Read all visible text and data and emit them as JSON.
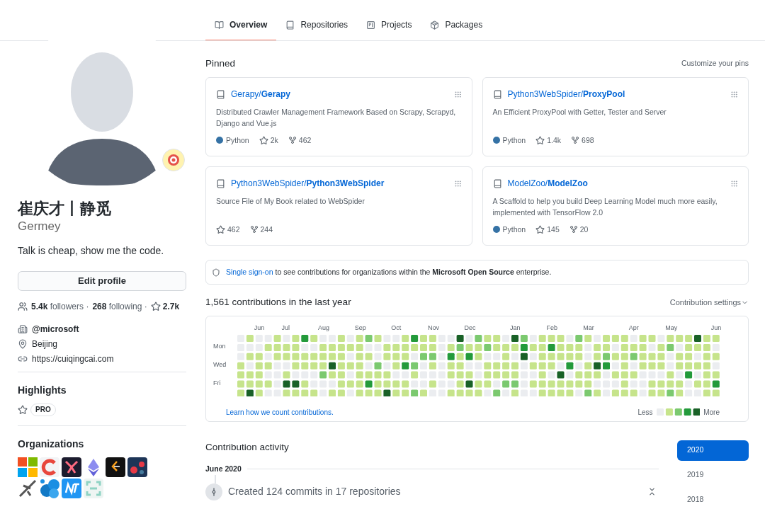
{
  "tabs": [
    {
      "label": "Overview",
      "kind": "overview",
      "selected": true
    },
    {
      "label": "Repositories",
      "kind": "repo",
      "selected": false
    },
    {
      "label": "Projects",
      "kind": "project",
      "selected": false
    },
    {
      "label": "Packages",
      "kind": "package",
      "selected": false
    }
  ],
  "profile": {
    "name": "崔庆才丨静觅",
    "username": "Germey",
    "bio": "Talk is cheap, show me the code.",
    "edit_button": "Edit profile",
    "followers": "**5.4k** followers ·",
    "following": "**268** following ·",
    "stars": "**2.7k**",
    "details": [
      {
        "kind": "org",
        "text": "@microsoft"
      },
      {
        "kind": "location",
        "text": "Beijing"
      },
      {
        "kind": "link",
        "text": "https://cuiqingcai.com"
      }
    ],
    "highlights_title": "Highlights",
    "highlight_badge": "PRO",
    "organizations_title": "Organizations"
  },
  "pinned": {
    "title": "Pinned",
    "customize": "Customize your pins",
    "repos": [
      {
        "owner": "Gerapy/",
        "name": "Gerapy",
        "description": "Distributed Crawler Management Framework Based on Scrapy, Scrapyd, Django and Vue.js",
        "language": "Python",
        "color": "#3572a5",
        "stars": "2k",
        "forks": "462"
      },
      {
        "owner": "Python3WebSpider/",
        "name": "ProxyPool",
        "description": "An Efficient ProxyPool with Getter, Tester and Server",
        "language": "Python",
        "color": "#3572a5",
        "stars": "1.4k",
        "forks": "698"
      },
      {
        "owner": "Python3WebSpider/",
        "name": "Python3WebSpider",
        "description": "Source File of My Book related to WebSpider",
        "stars": "462",
        "forks": "244"
      },
      {
        "owner": "ModelZoo/",
        "name": "ModelZoo",
        "description": "A Scaffold to help you build Deep Learning Model much more easily, implemented with TensorFlow 2.0",
        "language": "Python",
        "color": "#3572a5",
        "stars": "145",
        "forks": "20"
      }
    ]
  },
  "sso_notice": {
    "link": "Single sign-on",
    "text": "to see contributions for organizations within the **Microsoft Open Source** enterprise."
  },
  "contributions": {
    "title": "1,561 contributions in the last year",
    "settings": "Contribution settings",
    "months": [
      "Jun",
      "Jul",
      "Aug",
      "Sep",
      "Oct",
      "Nov",
      "Dec",
      "Jan",
      "Feb",
      "Mar",
      "Apr",
      "May",
      "Jun"
    ],
    "days": [
      "Mon",
      "Wed",
      "Fri"
    ],
    "learn_link": "Learn how we count contributions.",
    "less": "Less",
    "more": "More"
  },
  "activity": {
    "title": "Contribution activity",
    "month": "June 2020",
    "event": "Created 124 commits in 17 repositories",
    "years": [
      {
        "label": "2020",
        "selected": true
      },
      {
        "label": "2019",
        "selected": false
      },
      {
        "label": "2018",
        "selected": false
      }
    ]
  }
}
